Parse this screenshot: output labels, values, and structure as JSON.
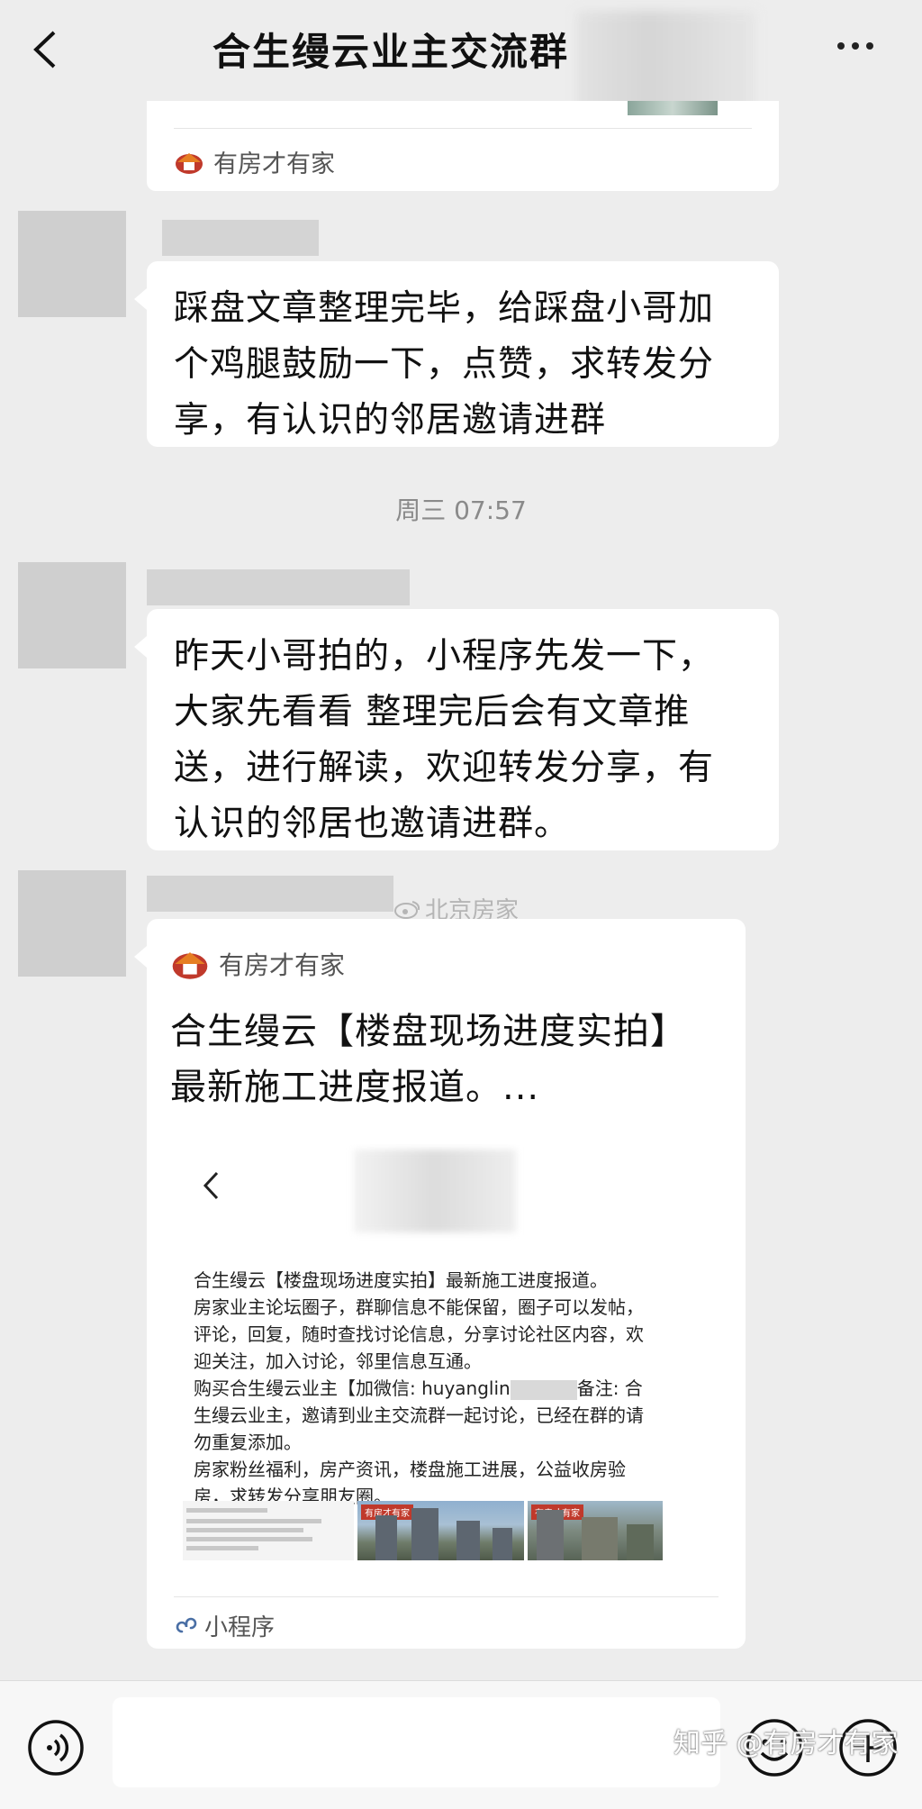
{
  "header": {
    "title": "合生缦云业主交流群",
    "back_icon": "chevron-left-icon",
    "more_icon": "more-icon"
  },
  "messages": [
    {
      "type": "share_card_footer",
      "source": "有房才有家"
    },
    {
      "type": "text",
      "lines": [
        "踩盘文章整理完毕，给踩盘小哥加",
        "个鸡腿鼓励一下，点赞，求转发分",
        "享，有认识的邻居邀请进群"
      ]
    },
    {
      "type": "timestamp",
      "text": "周三 07:57"
    },
    {
      "type": "text",
      "lines": [
        "昨天小哥拍的，小程序先发一下，",
        "大家先看看 整理完后会有文章推",
        "送，进行解读，欢迎转发分享，有",
        "认识的邻居也邀请进群。"
      ]
    },
    {
      "type": "mini_program",
      "source": "有房才有家",
      "title_lines": [
        "合生缦云【楼盘现场进度实拍】",
        "最新施工进度报道。..."
      ],
      "preview_lines": [
        "合生缦云【楼盘现场进度实拍】最新施工进度报道。",
        "房家业主论坛圈子，群聊信息不能保留，圈子可以发帖，",
        "评论，回复，随时查找讨论信息，分享讨论社区内容，欢",
        "迎关注，加入讨论，邻里信息互通。"
      ],
      "preview_wechat_prefix": "购买合生缦云业主【加微信: huyanglin",
      "preview_wechat_suffix": "备注: 合",
      "preview_lines_after": [
        "生缦云业主，邀请到业主交流群一起讨论，已经在群的请",
        "勿重复添加。",
        "房家粉丝福利，房产资讯，楼盘施工进展，公益收房验",
        "房，求转发分享朋友圈。"
      ],
      "thumb_tags": [
        "有房才有家",
        "有房才有家"
      ],
      "footer_label": "小程序"
    }
  ],
  "watermarks": {
    "weibo": "北京房家",
    "zhihu": "知乎 @有房才有家"
  },
  "inputbar": {
    "voice_icon": "voice-icon",
    "emoji_icon": "emoji-icon",
    "plus_icon": "plus-icon"
  }
}
